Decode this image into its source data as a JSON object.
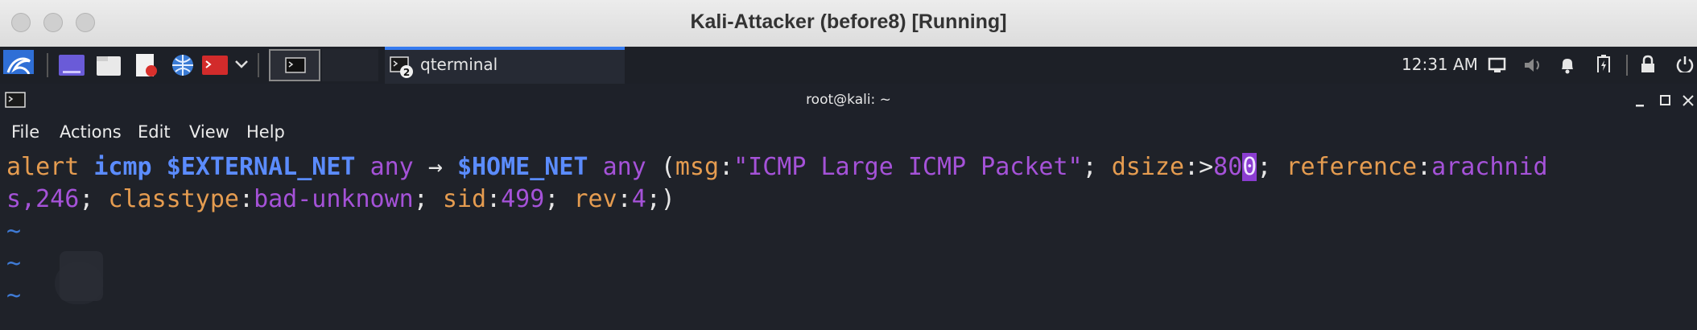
{
  "window": {
    "title": "Kali-Attacker (before8) [Running]"
  },
  "panel": {
    "task_label": "qterminal",
    "task_badge": "2",
    "clock": "12:31 AM"
  },
  "terminal": {
    "title": "root@kali: ~",
    "menu": [
      "File",
      "Actions",
      "Edit",
      "View",
      "Help"
    ],
    "line1": {
      "t1": "alert ",
      "t2": "icmp ",
      "t3": "$EXTERNAL_NET ",
      "t4": "any ",
      "t5": "→ ",
      "t6": "$HOME_NET ",
      "t7": "any ",
      "t8": "(",
      "t9": "msg",
      "t10": ":",
      "t11": "\"ICMP Large ICMP Packet\"",
      "t12": "; ",
      "t13": "dsize",
      "t14": ":>",
      "t15": "80",
      "t16": "0",
      "t17": "; ",
      "t18": "reference",
      "t19": ":",
      "t20": "arachnid"
    },
    "line2": {
      "t1": "s,",
      "t2": "246",
      "t3": "; ",
      "t4": "classtype",
      "t5": ":",
      "t6": "bad-unknown",
      "t7": "; ",
      "t8": "sid",
      "t9": ":",
      "t10": "499",
      "t11": "; ",
      "t12": "rev",
      "t13": ":",
      "t14": "4",
      "t15": ";)"
    },
    "tilde": "~"
  }
}
